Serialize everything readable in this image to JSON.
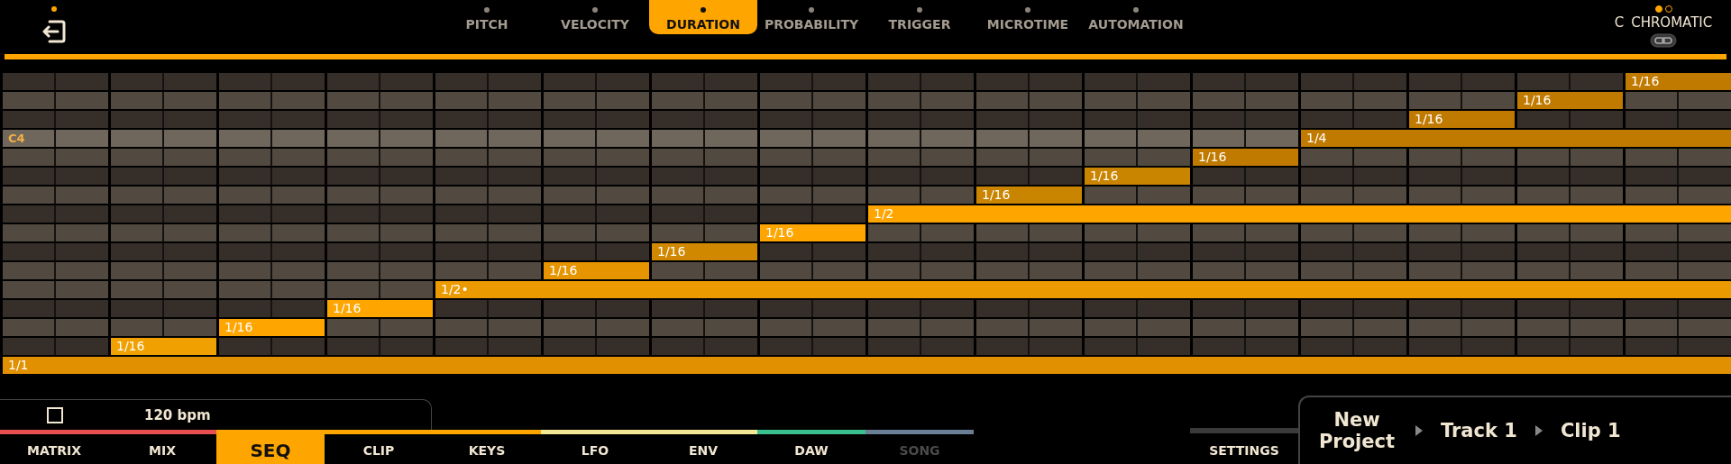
{
  "top_tabs": [
    {
      "label": "PITCH",
      "selected": false
    },
    {
      "label": "VELOCITY",
      "selected": false
    },
    {
      "label": "DURATION",
      "selected": true
    },
    {
      "label": "PROBABILITY",
      "selected": false
    },
    {
      "label": "TRIGGER",
      "selected": false
    },
    {
      "label": "MICROTIME",
      "selected": false
    },
    {
      "label": "AUTOMATION",
      "selected": false
    }
  ],
  "scale": {
    "root": "C",
    "name": "CHROMATIC"
  },
  "piano_roll": {
    "lanes": [
      {
        "kind": "black",
        "notes": [
          {
            "label": "1/16",
            "kind": "short",
            "color": "#c07a00"
          }
        ]
      },
      {
        "kind": "white",
        "notes": [
          {
            "label": "1/16",
            "kind": "short",
            "color": "#c07a00"
          }
        ]
      },
      {
        "kind": "black",
        "notes": [
          {
            "label": "1/16",
            "kind": "short",
            "color": "#c07a00"
          }
        ]
      },
      {
        "kind": "root",
        "label": "C4",
        "notes": [
          {
            "label": "1/4",
            "kind": "long",
            "color": "#c07a00"
          }
        ]
      },
      {
        "kind": "white",
        "notes": [
          {
            "label": "1/16",
            "kind": "short",
            "color": "#c07a00"
          }
        ]
      },
      {
        "kind": "black",
        "notes": [
          {
            "label": "1/16",
            "kind": "short",
            "color": "#c98400"
          }
        ]
      },
      {
        "kind": "white",
        "notes": [
          {
            "label": "1/16",
            "kind": "short",
            "color": "#c98400"
          }
        ]
      },
      {
        "kind": "black",
        "notes": [
          {
            "label": "1/2",
            "kind": "long",
            "color": "#ffa500"
          }
        ]
      },
      {
        "kind": "white",
        "notes": [
          {
            "label": "1/16",
            "kind": "short",
            "color": "#ffa500"
          }
        ]
      },
      {
        "kind": "black",
        "notes": [
          {
            "label": "1/16",
            "kind": "short",
            "color": "#d08800"
          }
        ]
      },
      {
        "kind": "white",
        "notes": [
          {
            "label": "1/16",
            "kind": "short",
            "color": "#e69500"
          }
        ]
      },
      {
        "kind": "white",
        "notes": [
          {
            "label": "1/2•",
            "kind": "long",
            "color": "#eb9a00"
          }
        ]
      },
      {
        "kind": "black",
        "notes": [
          {
            "label": "1/16",
            "kind": "short",
            "color": "#ffa500"
          }
        ]
      },
      {
        "kind": "white",
        "notes": [
          {
            "label": "1/16",
            "kind": "short",
            "color": "#ffa500"
          }
        ]
      },
      {
        "kind": "black",
        "notes": [
          {
            "label": "1/16",
            "kind": "short",
            "color": "#f0a000"
          }
        ]
      },
      {
        "notes": [
          {
            "label": "1/1",
            "kind": "long",
            "color": "#e09000"
          }
        ]
      }
    ]
  },
  "transport": {
    "checkbox": {
      "checked": false
    },
    "tempo": "120 bpm"
  },
  "bottom_tabs": [
    {
      "label": "MATRIX",
      "color": "#e85050",
      "selected": false,
      "disabled": false
    },
    {
      "label": "MIX",
      "color": "#e85050",
      "selected": false,
      "disabled": false
    },
    {
      "label": "SEQ",
      "color": "#ffa500",
      "selected": true,
      "disabled": false
    },
    {
      "label": "CLIP",
      "color": "#ffa500",
      "selected": false,
      "disabled": false
    },
    {
      "label": "KEYS",
      "color": "#ffa500",
      "selected": false,
      "disabled": false
    },
    {
      "label": "LFO",
      "color": "#f2e896",
      "selected": false,
      "disabled": false
    },
    {
      "label": "ENV",
      "color": "#f2e896",
      "selected": false,
      "disabled": false
    },
    {
      "label": "DAW",
      "color": "#3cbf8f",
      "selected": false,
      "disabled": false
    },
    {
      "label": "SONG",
      "color": "#6a7f95",
      "selected": false,
      "disabled": true
    }
  ],
  "settings": {
    "label": "SETTINGS"
  },
  "breadcrumb": [
    "New Project",
    "Track 1",
    "Clip 1"
  ]
}
